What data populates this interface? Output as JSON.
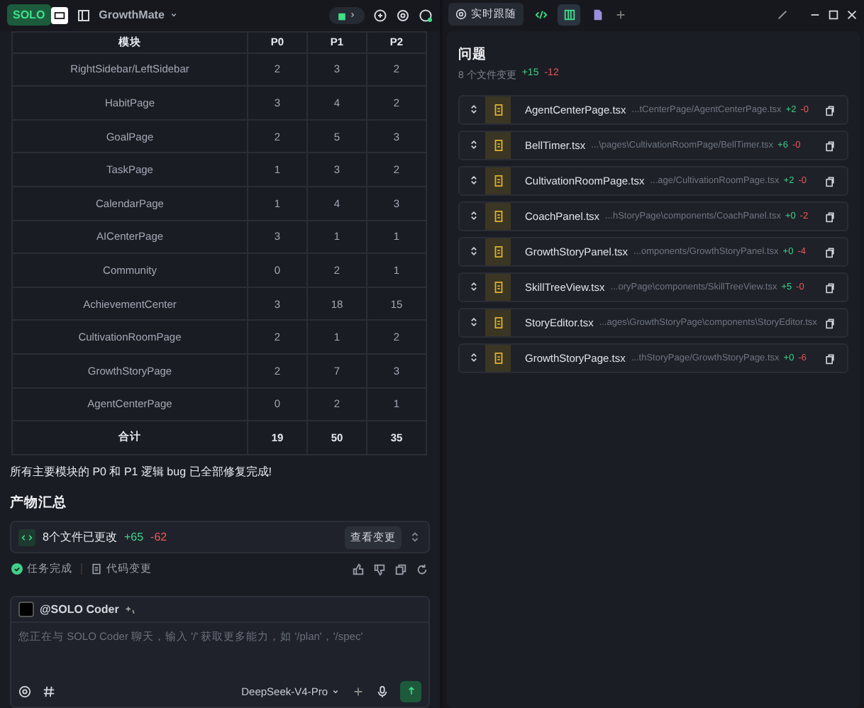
{
  "top_bar": {
    "logo": "SOLO",
    "project": "GrowthMate"
  },
  "table": {
    "columns": [
      "模块",
      "P0",
      "P1",
      "P2"
    ],
    "rows": [
      [
        "RightSidebar/LeftSidebar",
        "2",
        "3",
        "2"
      ],
      [
        "HabitPage",
        "3",
        "4",
        "2"
      ],
      [
        "GoalPage",
        "2",
        "5",
        "3"
      ],
      [
        "TaskPage",
        "1",
        "3",
        "2"
      ],
      [
        "CalendarPage",
        "1",
        "4",
        "3"
      ],
      [
        "AICenterPage",
        "3",
        "1",
        "1"
      ],
      [
        "Community",
        "0",
        "2",
        "1"
      ],
      [
        "AchievementCenter",
        "3",
        "18",
        "15"
      ],
      [
        "CultivationRoomPage",
        "2",
        "1",
        "2"
      ],
      [
        "GrowthStoryPage",
        "2",
        "7",
        "3"
      ],
      [
        "AgentCenterPage",
        "0",
        "2",
        "1"
      ]
    ],
    "total": [
      "合计",
      "19",
      "50",
      "35"
    ]
  },
  "summary_text": "所有主要模块的 P0 和 P1 逻辑 bug 已全部修复完成!",
  "artifacts": {
    "title": "产物汇总",
    "files_changed": "8个文件已更改",
    "added": "+65",
    "removed": "-62",
    "button": "查看变更"
  },
  "status": [
    {
      "kind": "done",
      "label": "任务完成"
    },
    {
      "kind": "code",
      "label": "代码变更"
    }
  ],
  "chat": {
    "agent": "@SOLO Coder",
    "placeholder": "您正在与 SOLO Coder 聊天，输入 '/' 获取更多能力，如 '/plan'，'/spec'",
    "model": "DeepSeek-V4-Pro"
  },
  "right_panel": {
    "follow_tab": "实时跟随",
    "tabs": [
      {
        "kind": "code",
        "selected": false
      },
      {
        "kind": "table",
        "selected": true
      },
      {
        "kind": "file",
        "selected": false
      }
    ],
    "title": "问题",
    "summary": "8 个文件变更",
    "added": "+15",
    "removed": "-12",
    "files": [
      {
        "name": "AgentCenterPage.tsx",
        "path": "...tCenterPage/AgentCenterPage.tsx",
        "added": "+2",
        "removed": "-0"
      },
      {
        "name": "BellTimer.tsx",
        "path": "...\\pages\\CultivationRoomPage/BellTimer.tsx",
        "added": "+6",
        "removed": "-0"
      },
      {
        "name": "CultivationRoomPage.tsx",
        "path": "...age/CultivationRoomPage.tsx",
        "added": "+2",
        "removed": "-0"
      },
      {
        "name": "CoachPanel.tsx",
        "path": "...hStoryPage\\components/CoachPanel.tsx",
        "added": "+0",
        "removed": "-2"
      },
      {
        "name": "GrowthStoryPanel.tsx",
        "path": "...omponents/GrowthStoryPanel.tsx",
        "added": "+0",
        "removed": "-4"
      },
      {
        "name": "SkillTreeView.tsx",
        "path": "...oryPage\\components/SkillTreeView.tsx",
        "added": "+5",
        "removed": "-0"
      },
      {
        "name": "StoryEditor.tsx",
        "path": "...ages\\GrowthStoryPage\\components\\StoryEditor.tsx"
      },
      {
        "name": "GrowthStoryPage.tsx",
        "path": "...thStoryPage/GrowthStoryPage.tsx",
        "added": "+0",
        "removed": "-6"
      }
    ]
  }
}
